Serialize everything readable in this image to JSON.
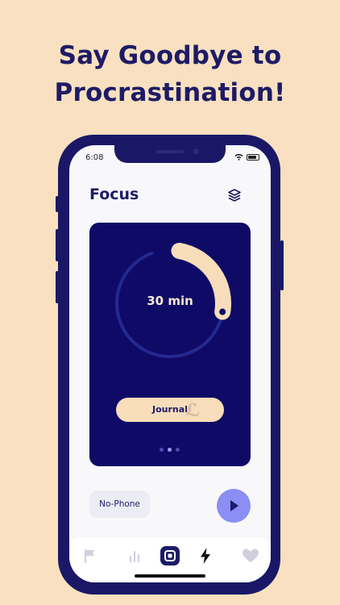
{
  "headline": {
    "line1": "Say Goodbye to",
    "line2": "Procrastination!"
  },
  "status_bar": {
    "time": "6:08",
    "icons": [
      "wifi-icon",
      "battery-icon"
    ]
  },
  "header": {
    "title": "Focus",
    "action_icon": "layers-icon"
  },
  "session_card": {
    "timer_label": "30 min",
    "progress_fraction": 0.22,
    "activity_label": "Journal",
    "page_dots": 3,
    "active_dot": 2
  },
  "controls": {
    "mode_label": "No-Phone",
    "play_icon": "play-icon"
  },
  "tab_bar": {
    "items": [
      {
        "icon": "flag-icon",
        "active": false
      },
      {
        "icon": "stats-icon",
        "active": false
      },
      {
        "icon": "focus-icon",
        "active": true
      },
      {
        "icon": "bolt-icon",
        "active": false
      },
      {
        "icon": "heart-icon",
        "active": false
      }
    ]
  },
  "colors": {
    "background": "#f8e0c0",
    "navy": "#1d1b66",
    "card": "#0f0a66",
    "accent": "#8a8ef5",
    "cream": "#f7ddb9"
  }
}
